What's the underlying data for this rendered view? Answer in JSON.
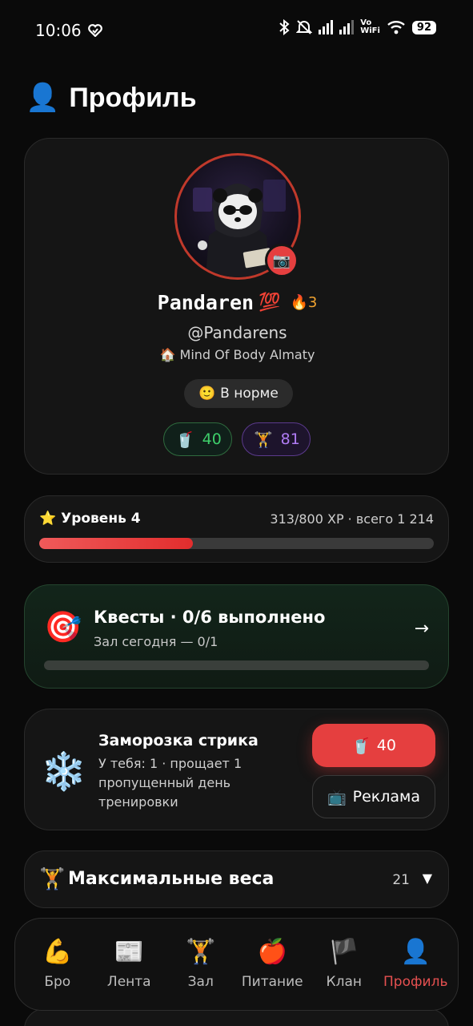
{
  "status_bar": {
    "time": "10:06",
    "vowifi_line1": "Vo",
    "vowifi_line2": "WiFi",
    "battery": "92"
  },
  "header": {
    "title": "Профиль",
    "icon": "👤"
  },
  "profile": {
    "name": "Pandaren",
    "name_emoji": "💯",
    "streak_icon": "🔥",
    "streak": "3",
    "username": "@Pandarens",
    "gym_icon": "🏠",
    "gym": "Mind Of Body Almaty",
    "camera_icon": "📷",
    "mood_icon": "🙂",
    "mood": "В норме",
    "stats": [
      {
        "icon": "🥤",
        "value": "40"
      },
      {
        "icon": "🏋",
        "value": "81"
      }
    ]
  },
  "level": {
    "icon": "⭐",
    "title": "Уровень 4",
    "xp": "313/800 XP · всего 1 214",
    "progress": 0.39
  },
  "quests": {
    "icon": "🎯",
    "title": "Квесты · 0/6 выполнено",
    "subtitle": "Зал сегодня — 0/1",
    "arrow": "→",
    "progress": 0
  },
  "freeze": {
    "icon": "❄️",
    "title": "Заморозка стрика",
    "description": "У тебя: 1 · прощает 1 пропущенный день тренировки",
    "buy_icon": "🥤",
    "buy_label": "40",
    "ad_icon": "📺",
    "ad_label": "Реклама"
  },
  "max_weights": {
    "icon": "🏋",
    "title": "Максимальные веса",
    "count": "21",
    "chevron": "▼"
  },
  "bottom_nav": [
    {
      "icon": "💪",
      "label": "Бро",
      "active": false
    },
    {
      "icon": "📰",
      "label": "Лента",
      "active": false
    },
    {
      "icon": "🏋",
      "label": "Зал",
      "active": false
    },
    {
      "icon": "🍎",
      "label": "Питание",
      "active": false
    },
    {
      "icon": "🏴",
      "label": "Клан",
      "active": false
    },
    {
      "icon": "👤",
      "label": "Профиль",
      "active": true
    }
  ],
  "colors": {
    "accent_red": "#e53f3f",
    "green": "#3ecf6a",
    "purple": "#b07cf5",
    "streak_orange": "#f0a330"
  }
}
